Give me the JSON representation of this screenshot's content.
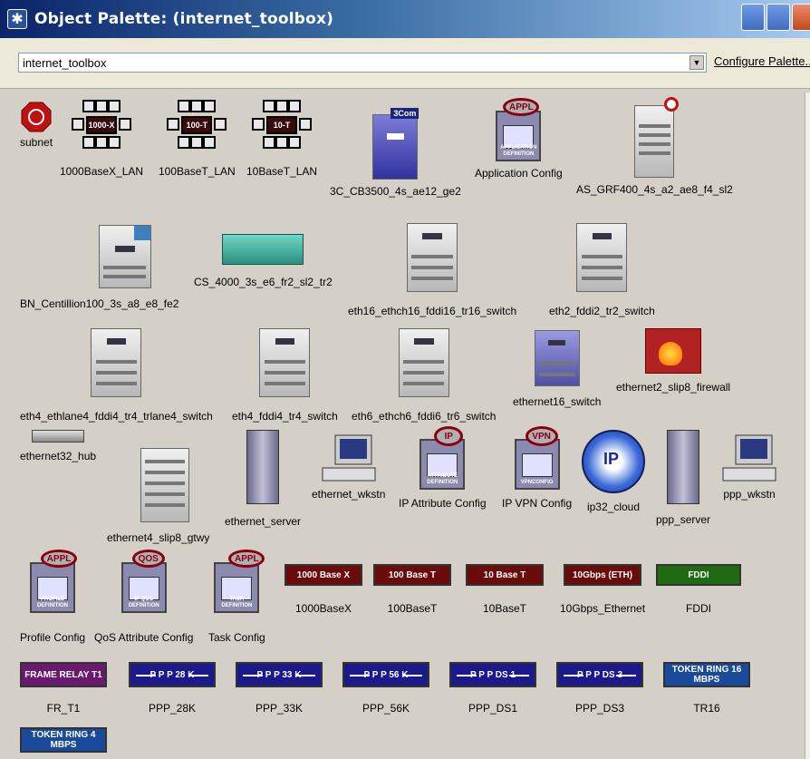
{
  "window": {
    "title": "Object Palette: (internet_toolbox)"
  },
  "toolbar": {
    "palette_value": "internet_toolbox",
    "configure_label": "Configure Palette..."
  },
  "colors": {
    "lan_core": "#3a0a0a",
    "appl_ring": "#8a0010",
    "link_red": "#6b0a0a",
    "link_green": "#1f6b12",
    "link_blue": "#1a1a8c",
    "link_purple": "#6a1a6e",
    "link_teal": "#1a4a9a"
  },
  "items": {
    "subnet": "subnet",
    "lan_1000": {
      "label": "1000BaseX_LAN",
      "badge": "1000-X"
    },
    "lan_100": {
      "label": "100BaseT_LAN",
      "badge": "100-T"
    },
    "lan_10": {
      "label": "10BaseT_LAN",
      "badge": "10-T"
    },
    "cb3500": {
      "label": "3C_CB3500_4s_ae12_ge2",
      "brand": "3Com"
    },
    "app_config": {
      "label": "Application Config",
      "badge": "APPL",
      "caption": "APPLICATION DEFINITION"
    },
    "as_grf": "AS_GRF400_4s_a2_ae8_f4_sl2",
    "bn_cent": "BN_Centillion100_3s_a8_e8_fe2",
    "cs4000": "CS_4000_3s_e6_fr2_sl2_tr2",
    "eth16_sw": "eth16_ethch16_fddi16_tr16_switch",
    "eth2_sw": "eth2_fddi2_tr2_switch",
    "eth4_trl": "eth4_ethlane4_fddi4_tr4_trlane4_switch",
    "eth4_sw": "eth4_fddi4_tr4_switch",
    "eth6_sw": "eth6_ethch6_fddi6_tr6_switch",
    "ethernet16_switch": "ethernet16_switch",
    "firewall": "ethernet2_slip8_firewall",
    "hub32": "ethernet32_hub",
    "gtwy": "ethernet4_slip8_gtwy",
    "eth_server": "ethernet_server",
    "eth_wkstn": "ethernet_wkstn",
    "ip_attr": {
      "label": "IP Attribute Config",
      "badge": "IP",
      "caption": "ATTRIBUTE DEFINITION"
    },
    "ip_vpn": {
      "label": "IP VPN Config",
      "badge": "VPN",
      "caption": "VPNCONFIG"
    },
    "ip32_cloud": {
      "label": "ip32_cloud",
      "badge": "IP"
    },
    "ppp_server": "ppp_server",
    "ppp_wkstn": "ppp_wkstn",
    "profile_cfg": {
      "label": "Profile Config",
      "badge": "APPL",
      "caption": "PROFILE DEFINITION"
    },
    "qos_cfg": {
      "label": "QoS Attribute Config",
      "badge": "QOS",
      "caption": "IP QOS DEFINITION"
    },
    "task_cfg": {
      "label": "Task Config",
      "badge": "APPL",
      "caption": "TASK DEFINITION"
    },
    "link_1000": {
      "label": "1000BaseX",
      "bar": "1000 Base X"
    },
    "link_100": {
      "label": "100BaseT",
      "bar": "100 Base T"
    },
    "link_10": {
      "label": "10BaseT",
      "bar": "10 Base T"
    },
    "link_10g": {
      "label": "10Gbps_Ethernet",
      "bar": "10Gbps (ETH)"
    },
    "link_fddi": {
      "label": "FDDI",
      "bar": "FDDI"
    },
    "link_fr": {
      "label": "FR_T1",
      "bar": "FRAME RELAY T1"
    },
    "link_28": {
      "label": "PPP_28K",
      "bar": "P P P 28 K"
    },
    "link_33": {
      "label": "PPP_33K",
      "bar": "P P P 33 K"
    },
    "link_56": {
      "label": "PPP_56K",
      "bar": "P P P 56 K"
    },
    "link_ds1": {
      "label": "PPP_DS1",
      "bar": "P P P DS 1"
    },
    "link_ds3": {
      "label": "PPP_DS3",
      "bar": "P P P DS 3"
    },
    "link_tr16": {
      "label": "TR16",
      "bar": "TOKEN RING 16 MBPS"
    },
    "link_tr4": {
      "bar": "TOKEN RING 4 MBPS"
    }
  }
}
